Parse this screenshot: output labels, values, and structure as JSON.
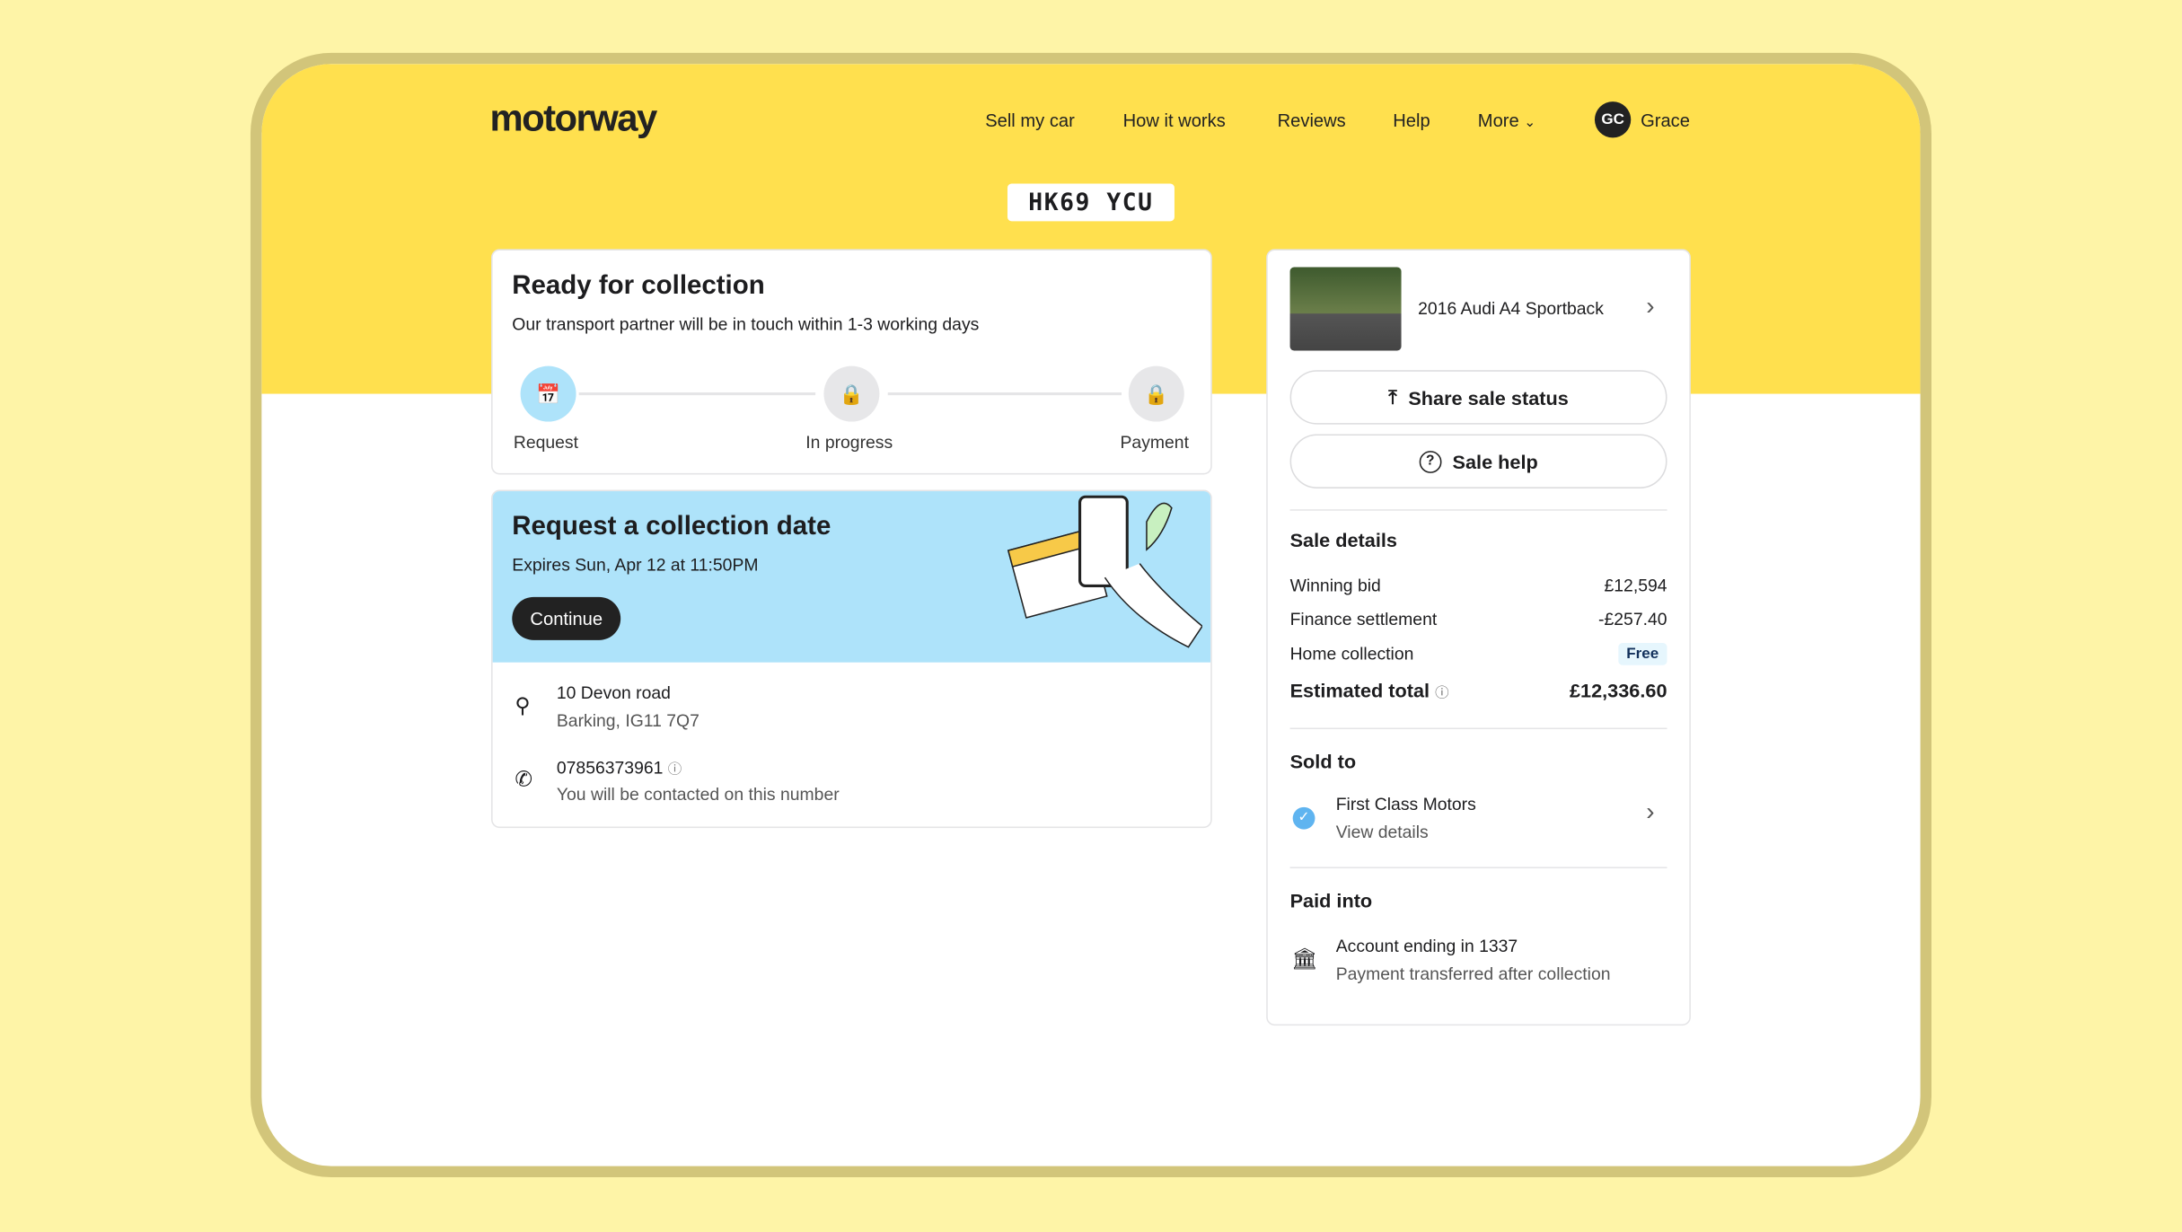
{
  "brand": "motorway",
  "nav": {
    "items": [
      "Sell my car",
      "How it works",
      "Reviews",
      "Help",
      "More"
    ],
    "avatar_initials": "GC",
    "user": "Grace"
  },
  "plate": "HK69 YCU",
  "status": {
    "title": "Ready for collection",
    "subtitle": "Our transport partner will be in touch within 1-3 working days",
    "steps": [
      "Request",
      "In progress",
      "Payment"
    ]
  },
  "request": {
    "title": "Request a collection date",
    "expires": "Expires Sun, Apr 12 at 11:50PM",
    "continue": "Continue"
  },
  "address": {
    "line1": "10 Devon road",
    "line2": "Barking, IG11 7Q7"
  },
  "phone": {
    "number": "07856373961",
    "note": "You will be contacted on this number"
  },
  "car": {
    "name": "2016 Audi A4 Sportback"
  },
  "actions": {
    "share": "Share sale status",
    "help": "Sale help"
  },
  "sale": {
    "title": "Sale details",
    "rows": [
      {
        "label": "Winning bid",
        "value": "£12,594"
      },
      {
        "label": "Finance settlement",
        "value": "-£257.40"
      },
      {
        "label": "Home collection",
        "value": "Free"
      }
    ],
    "total_label": "Estimated total",
    "total": "£12,336.60"
  },
  "sold": {
    "title": "Sold to",
    "name": "First Class Motors",
    "link": "View details"
  },
  "paid": {
    "title": "Paid into",
    "account": "Account ending in 1337",
    "note": "Payment transferred after collection"
  },
  "colors": {
    "yellow": "#ffe04e",
    "blue": "#aee3fa"
  }
}
